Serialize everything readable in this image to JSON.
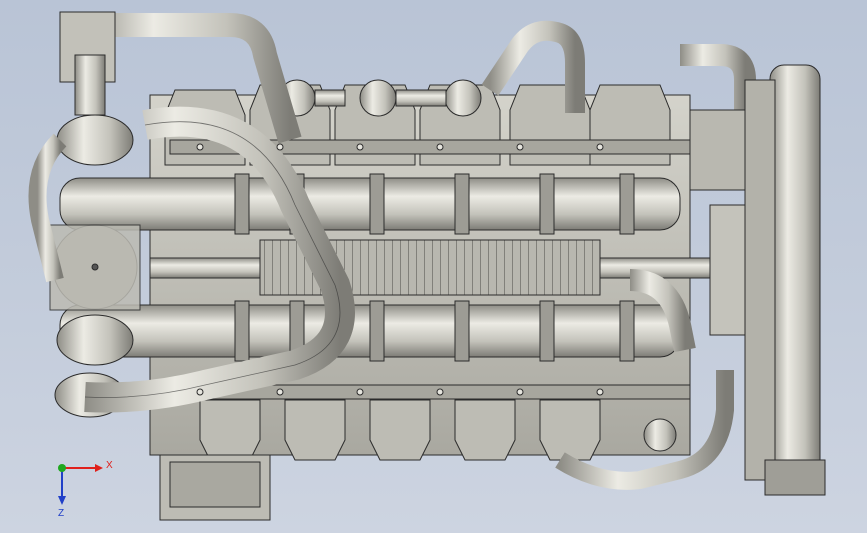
{
  "viewport": {
    "background_top": "#b9c4d6",
    "background_bottom": "#cdd4e1"
  },
  "model": {
    "metal_color": "#c7c6bd",
    "edge_color": "#2b2b2b"
  },
  "triad": {
    "x_label": "X",
    "z_label": "Z",
    "x_color": "#e0201b",
    "y_color": "#1fa81f",
    "z_color": "#2140c8"
  }
}
